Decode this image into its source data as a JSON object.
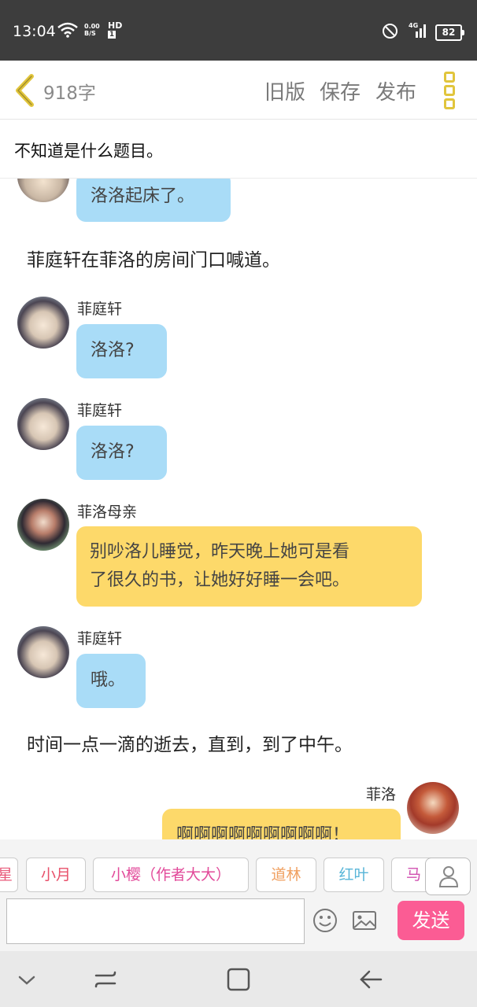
{
  "status": {
    "time": "13:04",
    "speed": "0.00",
    "speed_unit": "B/S",
    "hd": "HD",
    "hd_sub": "1",
    "network": "4G",
    "battery": "82"
  },
  "toolbar": {
    "word_count": "918字",
    "old_version": "旧版",
    "save": "保存",
    "publish": "发布"
  },
  "story": {
    "title": "不知道是什么题目。"
  },
  "messages": [
    {
      "type": "bubble",
      "text": "洛洛起床了。"
    },
    {
      "type": "narration",
      "text": "菲庭轩在菲洛的房间门口喊道。"
    },
    {
      "type": "bubble",
      "speaker": "菲庭轩",
      "text": "洛洛?"
    },
    {
      "type": "bubble",
      "speaker": "菲庭轩",
      "text": "洛洛?"
    },
    {
      "type": "bubble",
      "speaker": "菲洛母亲",
      "text_line1": "别吵洛儿睡觉，昨天晚上她可是看",
      "text_line2": "了很久的书，让她好好睡一会吧。"
    },
    {
      "type": "bubble",
      "speaker": "菲庭轩",
      "text": "哦。"
    },
    {
      "type": "narration",
      "text": "时间一点一滴的逝去，直到，到了中午。"
    },
    {
      "type": "bubble",
      "speaker": "菲洛",
      "text": "啊啊啊啊啊啊啊啊啊！"
    }
  ],
  "characters": [
    {
      "name": "星",
      "color": "#e85a7a"
    },
    {
      "name": "小月",
      "color": "#e8506a"
    },
    {
      "name": "小樱（作者大大）",
      "color": "#e24a9a"
    },
    {
      "name": "道林",
      "color": "#f0a060"
    },
    {
      "name": "红叶",
      "color": "#58b5d8"
    },
    {
      "name": "马",
      "color": "#d050b0"
    }
  ],
  "input": {
    "placeholder": "",
    "send_label": "发送"
  },
  "colors": {
    "blue_bubble": "#a9dcf7",
    "yellow_bubble": "#fdd96a",
    "send": "#fb5c94",
    "accent": "#e1c53c"
  }
}
